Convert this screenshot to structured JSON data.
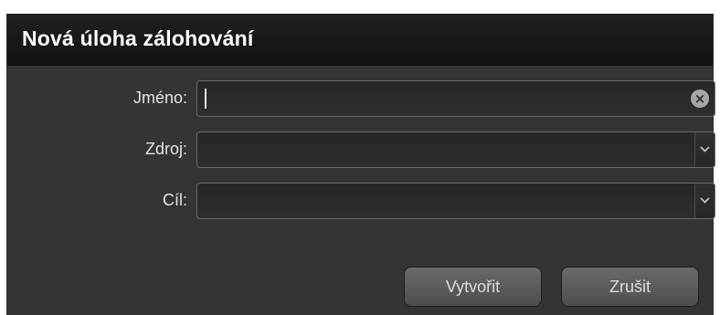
{
  "dialog": {
    "title": "Nová úloha zálohování"
  },
  "form": {
    "name_label": "Jméno:",
    "name_value": "",
    "source_label": "Zdroj:",
    "source_value": "",
    "target_label": "Cíl:",
    "target_value": ""
  },
  "buttons": {
    "create_label": "Vytvořit",
    "cancel_label": "Zrušit"
  },
  "icons": {
    "clear": "clear-icon",
    "dropdown": "chevron-down-icon"
  },
  "colors": {
    "dialog_bg": "#343434",
    "titlebar_bg": "#161616",
    "field_border": "#6b6b6b",
    "button_bg": "#5c5c5c",
    "text": "#e4e4e4"
  }
}
